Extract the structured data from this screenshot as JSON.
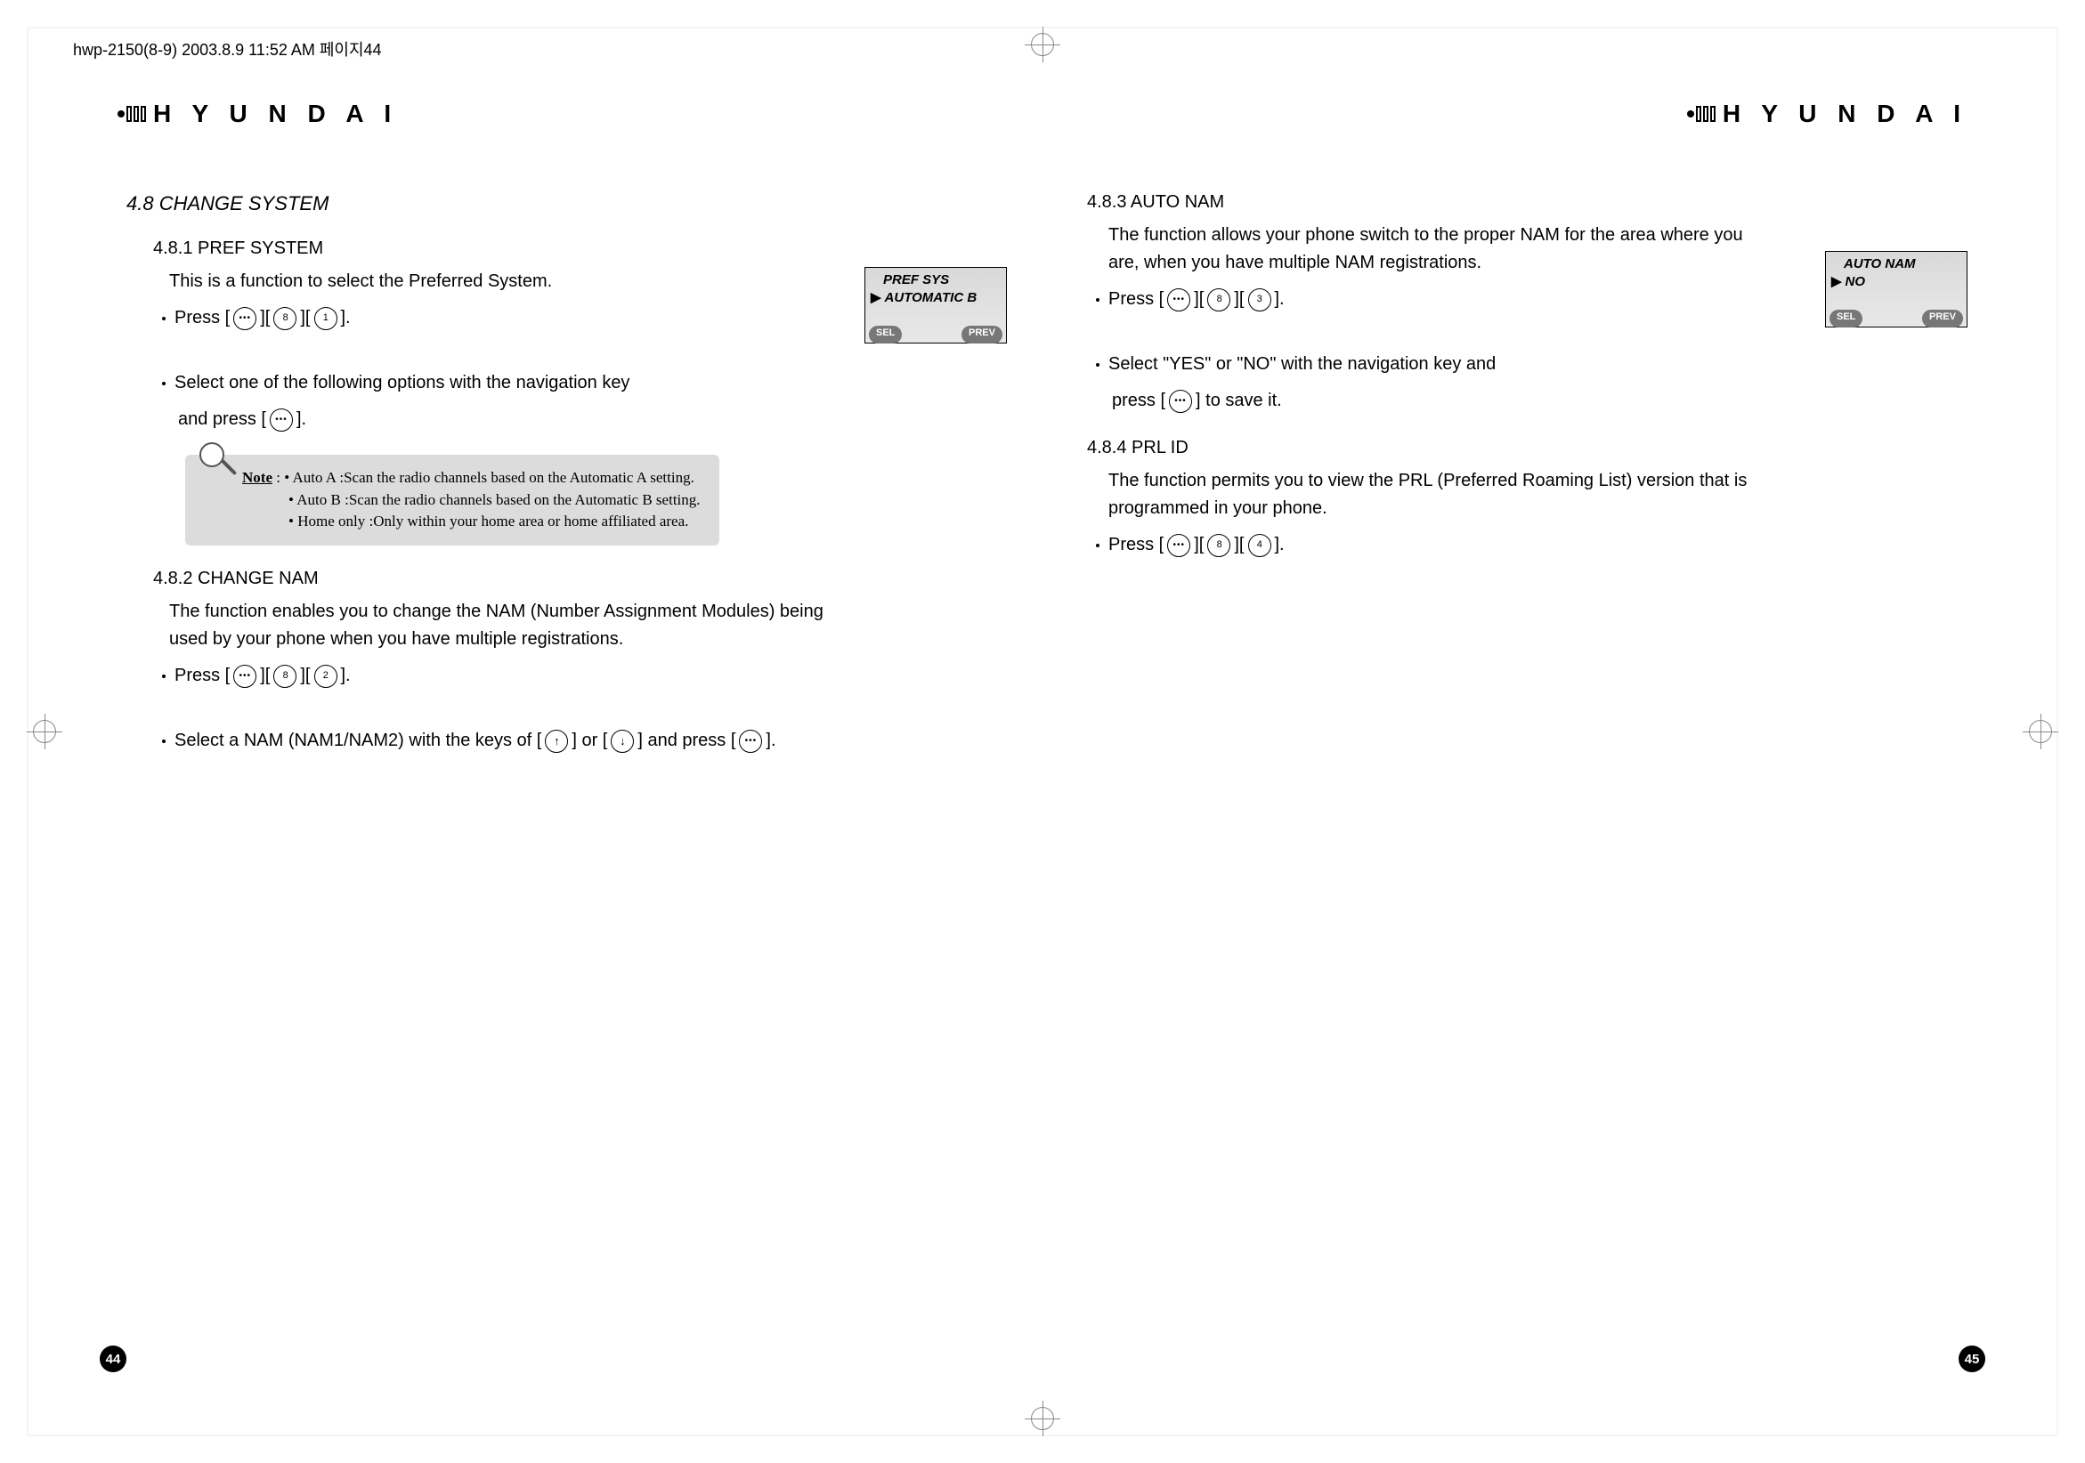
{
  "meta_header": "hwp-2150(8-9)  2003.8.9 11:52 AM  페이지44",
  "brand": "H Y U N D A I",
  "left_page": {
    "number": "44",
    "section_title": "4.8 CHANGE SYSTEM",
    "s481": {
      "title": "4.8.1 PREF SYSTEM",
      "desc": "This is a function to select the Preferred System.",
      "press_label": "Press [",
      "bracket_close": "].",
      "sep": "][",
      "key2": "8",
      "key3": "1",
      "step2a": "Select one of the following options with the navigation key",
      "step2b": "and press [",
      "step2c": " ].",
      "note_label": "Note",
      "note_intro": " : • Auto A :Scan the radio channels based on the Automatic A setting.",
      "note_b": "• Auto B :Scan the radio channels based on the Automatic B setting.",
      "note_c": "• Home only :Only within your home area or home affiliated area.",
      "screen": {
        "line1": "PREF SYS",
        "line2": "AUTOMATIC  B",
        "soft_left": "SEL",
        "soft_right": "PREV"
      }
    },
    "s482": {
      "title": "4.8.2 CHANGE NAM",
      "desc1": "The function enables you to change the NAM (Number Assignment Modules) being",
      "desc2": "used by your phone when you have multiple registrations.",
      "press_label": "Press [",
      "sep": "][",
      "bracket_close": "].",
      "key2": "8",
      "key3": "2",
      "step2a": "Select a NAM (NAM1/NAM2) with the keys of [",
      "step2b": "] or [",
      "step2c": "] and press [",
      "step2d": " ]."
    }
  },
  "right_page": {
    "number": "45",
    "s483": {
      "title": "4.8.3 AUTO NAM",
      "desc1": "The function allows your phone switch to the proper NAM for the area where you",
      "desc2": "are, when you have multiple NAM registrations.",
      "press_label": "Press [",
      "sep": "][",
      "bracket_close": "].",
      "key2": "8",
      "key3": "3",
      "step2a": "Select \"YES\" or \"NO\" with the navigation key and",
      "step2b": "press [",
      "step2c": " ] to save it.",
      "screen": {
        "line1": "AUTO NAM",
        "line2": "NO",
        "soft_left": "SEL",
        "soft_right": "PREV"
      }
    },
    "s484": {
      "title": "4.8.4 PRL ID",
      "desc1": "The function permits you to view the PRL (Preferred Roaming List) version that is",
      "desc2": "programmed in your phone.",
      "press_label": "Press [",
      "sep": "][",
      "bracket_close": "].",
      "key2": "8",
      "key3": "4"
    }
  }
}
